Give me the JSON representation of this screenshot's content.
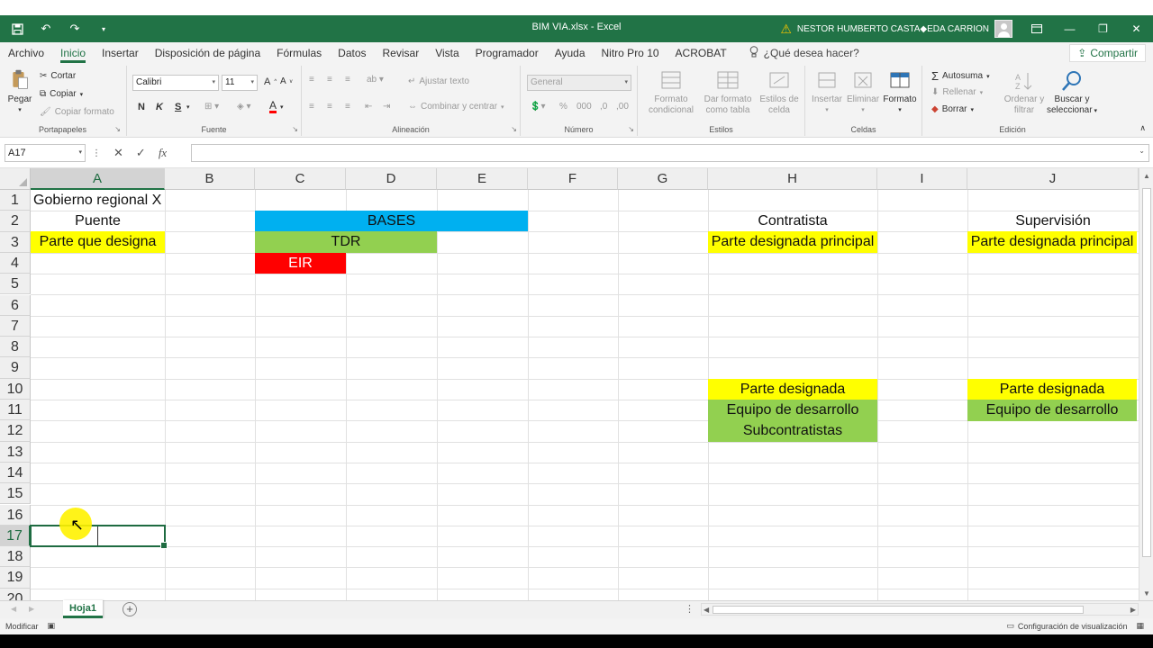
{
  "window": {
    "title": "BIM VIA.xlsx  -  Excel",
    "user": "NESTOR HUMBERTO CASTA◆EDA CARRION"
  },
  "tabs": [
    "Archivo",
    "Inicio",
    "Insertar",
    "Disposición de página",
    "Fórmulas",
    "Datos",
    "Revisar",
    "Vista",
    "Programador",
    "Ayuda",
    "Nitro Pro 10",
    "ACROBAT"
  ],
  "tellme": "¿Qué desea hacer?",
  "share": "Compartir",
  "ribbon": {
    "clipboard": {
      "label": "Portapapeles",
      "paste": "Pegar",
      "cut": "Cortar",
      "copy": "Copiar",
      "format_painter": "Copiar formato"
    },
    "font": {
      "label": "Fuente",
      "name": "Calibri",
      "size": "11",
      "bold": "N",
      "italic": "K",
      "underline": "S"
    },
    "alignment": {
      "label": "Alineación",
      "wrap": "Ajustar texto",
      "merge": "Combinar y centrar"
    },
    "number": {
      "label": "Número",
      "format": "General"
    },
    "styles": {
      "label": "Estilos",
      "conditional": [
        "Formato",
        "condicional"
      ],
      "table": [
        "Dar formato",
        "como tabla"
      ],
      "cell": [
        "Estilos de",
        "celda"
      ]
    },
    "cells": {
      "label": "Celdas",
      "insert": "Insertar",
      "delete": "Eliminar",
      "format": "Formato"
    },
    "editing": {
      "label": "Edición",
      "autosum": "Autosuma",
      "fill": "Rellenar",
      "clear": "Borrar",
      "sort": [
        "Ordenar y",
        "filtrar"
      ],
      "find": [
        "Buscar y",
        "seleccionar"
      ]
    }
  },
  "formula_bar": {
    "name_box": "A17",
    "fx": "fx",
    "value": ""
  },
  "columns": [
    "A",
    "B",
    "C",
    "D",
    "E",
    "F",
    "G",
    "H",
    "I",
    "J"
  ],
  "rows": [
    "1",
    "2",
    "3",
    "4",
    "5",
    "6",
    "7",
    "8",
    "9",
    "10",
    "11",
    "12",
    "13",
    "14",
    "15",
    "16",
    "17",
    "18",
    "19",
    "20"
  ],
  "cells": {
    "A1": "Gobierno regional X",
    "A2": "Puente",
    "A3": "Parte que designa",
    "C2": "BASES",
    "C3": "TDR",
    "C4": "EIR",
    "H2": "Contratista",
    "H3": "Parte designada principal",
    "H10": "Parte designada",
    "H11": "Equipo de desarrollo",
    "H12": "Subcontratistas",
    "J2": "Supervisión",
    "J3": "Parte designada principal",
    "J10": "Parte designada",
    "J11": "Equipo de desarrollo"
  },
  "colors": {
    "accent": "#217346",
    "yellow": "#ffff00",
    "green": "#92d050",
    "blue": "#00b0f0",
    "red": "#ff0000"
  },
  "sheet_tabs": [
    "Hoja1"
  ],
  "status": {
    "mode": "Modificar",
    "view_settings": "Configuración de visualización"
  }
}
